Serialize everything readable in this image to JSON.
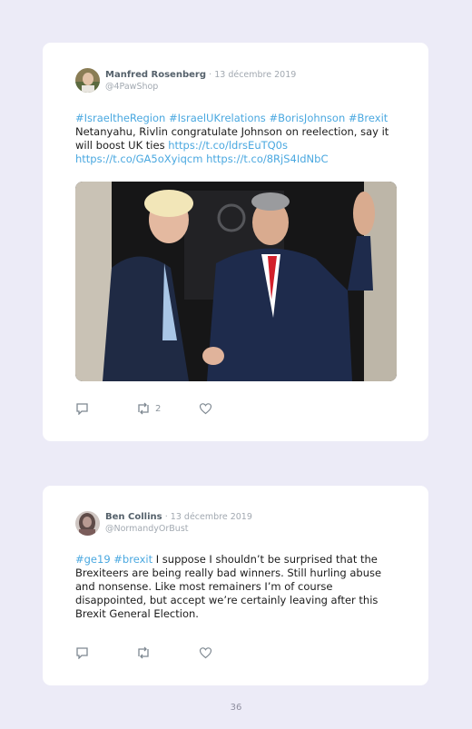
{
  "page_number": "36",
  "tweets": [
    {
      "author": "Manfred Rosenberg",
      "date": "· 13 décembre 2019",
      "handle": "@4PawShop",
      "text": {
        "tags": "#IsraeltheRegion #IsraelUKrelations #BorisJohnson #Brexit",
        "body": "Netanyahu, Rivlin congratulate Johnson on reelection, say it will boost UK ties ",
        "link1": "https://t.co/ldrsEuTQ0s",
        "link2": "https://t.co/GA5oXyiqcm https://t.co/8RjS4IdNbC"
      },
      "retweets": "2"
    },
    {
      "author": "Ben Collins",
      "date": "· 13 décembre 2019",
      "handle": "@NormandyOrBust",
      "text": {
        "tags": "#ge19 #brexit",
        "body": " I suppose I shouldn’t be surprised that the Brexiteers are being really bad winners. Still hurling abuse and nonsense. Like most remainers I’m of course disappointed, but accept we’re certainly leaving after this Brexit General Election."
      }
    }
  ]
}
